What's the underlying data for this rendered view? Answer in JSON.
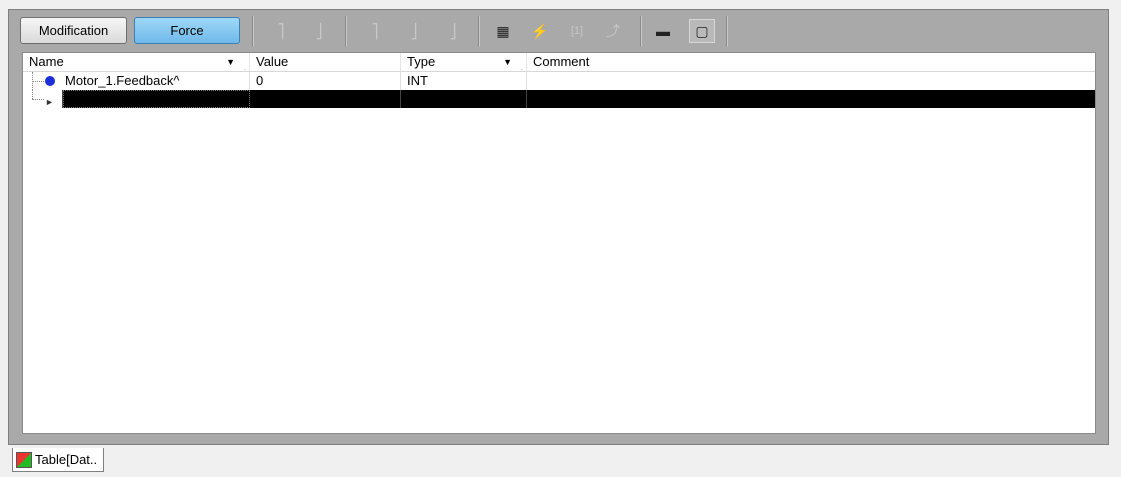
{
  "toolbar": {
    "modification_label": "Modification",
    "force_label": "Force",
    "icons": [
      {
        "name": "force-rising-edge-icon",
        "glyph": "⎤",
        "enabled": false
      },
      {
        "name": "force-falling-edge-icon",
        "glyph": "⎦",
        "enabled": false
      },
      {
        "name": "set-rising-icon",
        "glyph": "⎤",
        "enabled": false
      },
      {
        "name": "set-falling-icon",
        "glyph": "⎦",
        "enabled": false
      },
      {
        "name": "set-multiple-icon",
        "glyph": "⎦",
        "enabled": false
      },
      {
        "name": "grid-table-icon",
        "glyph": "▦",
        "enabled": true
      },
      {
        "name": "lightning-icon",
        "glyph": "⚡",
        "enabled": true
      },
      {
        "name": "bracket-value-icon",
        "glyph": "[1]",
        "enabled": false
      },
      {
        "name": "unforce-icon",
        "glyph": "⤴",
        "enabled": false
      },
      {
        "name": "display-format-icon",
        "glyph": "▬",
        "enabled": true
      },
      {
        "name": "select-area-icon",
        "glyph": "▢",
        "enabled": true
      }
    ]
  },
  "table": {
    "columns": [
      "Name",
      "Value",
      "Type",
      "Comment"
    ],
    "rows": [
      {
        "name": "Motor_1.Feedback^",
        "value": "0",
        "type": "INT",
        "comment": ""
      }
    ]
  },
  "bottom_tab": {
    "label": "Table[Dat.."
  }
}
